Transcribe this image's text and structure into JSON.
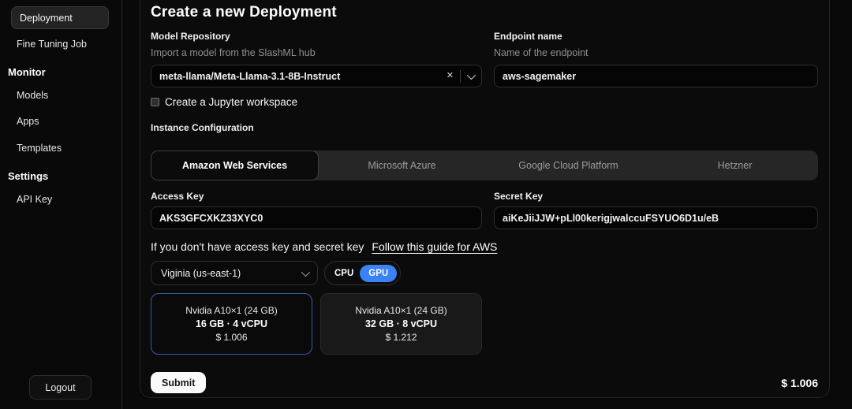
{
  "sidebar": {
    "items": [
      {
        "label": "Deployment",
        "selected": true
      },
      {
        "label": "Fine Tuning Job",
        "selected": false
      }
    ],
    "sections": [
      {
        "title": "Monitor",
        "items": [
          "Models",
          "Apps",
          "Templates"
        ]
      },
      {
        "title": "Settings",
        "items": [
          "API Key"
        ]
      }
    ],
    "logout_label": "Logout"
  },
  "main": {
    "title": "Create a new Deployment",
    "model_repository": {
      "label": "Model Repository",
      "description": "Import a model from the SlashML hub",
      "value": "meta-llama/Meta-Llama-3.1-8B-Instruct"
    },
    "endpoint": {
      "label": "Endpoint name",
      "description": "Name of the endpoint",
      "value": "aws-sagemaker"
    },
    "jupyter_checkbox_label": "Create a Jupyter workspace",
    "instance_configuration_label": "Instance Configuration",
    "provider_tabs": [
      {
        "label": "Amazon Web Services",
        "selected": true
      },
      {
        "label": "Microsoft Azure",
        "selected": false
      },
      {
        "label": "Google Cloud Platform",
        "selected": false
      },
      {
        "label": "Hetzner",
        "selected": false
      }
    ],
    "access_key": {
      "label": "Access Key",
      "value": "AKS3GFCXKZ33XYC0"
    },
    "secret_key": {
      "label": "Secret Key",
      "value": "aiKeJiiJJW+pLl00kerigjwalccuFSYUO6D1u/eB"
    },
    "guide": {
      "text": "If you don't have access key and secret key",
      "link_label": "Follow this guide for AWS"
    },
    "region_select": {
      "value": "Viginia (us-east-1)"
    },
    "compute_toggle": {
      "options": [
        "CPU",
        "GPU"
      ],
      "selected": "GPU"
    },
    "instances": [
      {
        "name": "Nvidia A10×1 (24 GB)",
        "specs": "16 GB · 4 vCPU",
        "price": "$ 1.006",
        "selected": true
      },
      {
        "name": "Nvidia A10×1 (24 GB)",
        "specs": "32 GB · 8 vCPU",
        "price": "$ 1.212",
        "selected": false
      }
    ],
    "submit_label": "Submit",
    "total_price": "$ 1.006"
  },
  "icons": {
    "clear_glyph": "✕"
  },
  "colors": {
    "accent_blue": "#3b82f6",
    "selected_card_border": "#2f5f9f",
    "page_background": "#090909"
  }
}
